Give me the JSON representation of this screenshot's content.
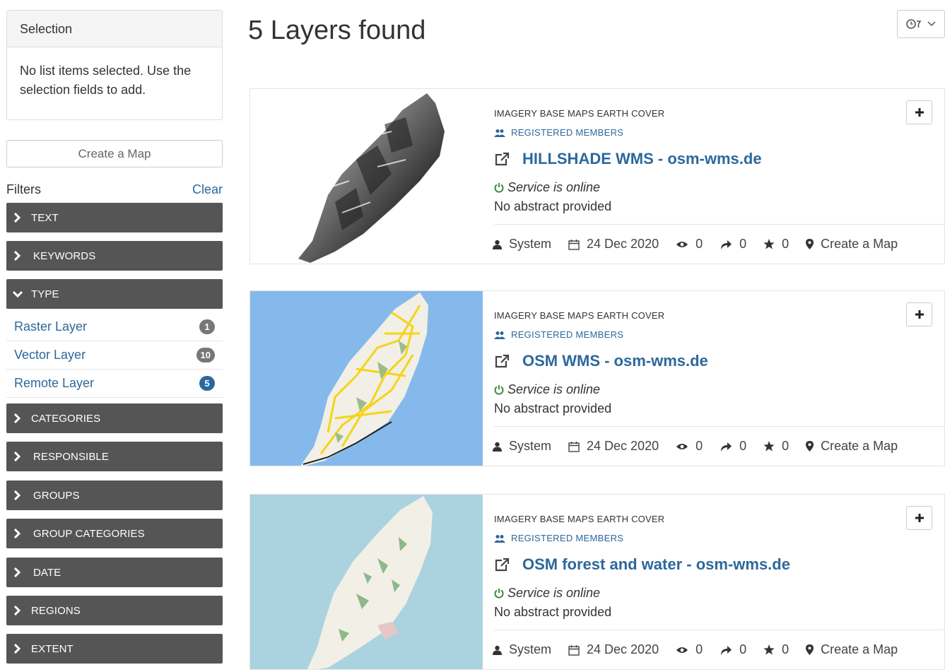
{
  "selection": {
    "header": "Selection",
    "empty_text": "No list items selected. Use the selection fields to add."
  },
  "create_map_label": "Create a Map",
  "filters": {
    "label": "Filters",
    "clear_label": "Clear",
    "sections": [
      {
        "label": "TEXT",
        "expanded": false
      },
      {
        "label": "KEYWORDS",
        "expanded": false
      },
      {
        "label": "TYPE",
        "expanded": true
      },
      {
        "label": "CATEGORIES",
        "expanded": false
      },
      {
        "label": "RESPONSIBLE",
        "expanded": false
      },
      {
        "label": "GROUPS",
        "expanded": false
      },
      {
        "label": "GROUP CATEGORIES",
        "expanded": false
      },
      {
        "label": "DATE",
        "expanded": false
      },
      {
        "label": "REGIONS",
        "expanded": false
      },
      {
        "label": "EXTENT",
        "expanded": false
      }
    ],
    "type_items": [
      {
        "label": "Raster Layer",
        "count": "1"
      },
      {
        "label": "Vector Layer",
        "count": "10"
      },
      {
        "label": "Remote Layer",
        "count": "5"
      }
    ]
  },
  "main": {
    "title": "5 Layers found",
    "sort_icon": "clock-sort-icon"
  },
  "layers": [
    {
      "categories": "IMAGERY BASE MAPS EARTH COVER",
      "permission": "REGISTERED MEMBERS",
      "title": "HILLSHADE WMS - osm-wms.de",
      "status": "Service is online",
      "abstract": "No abstract provided",
      "owner": "System",
      "date": "24 Dec 2020",
      "views": "0",
      "shares": "0",
      "stars": "0",
      "create_map": "Create a Map"
    },
    {
      "categories": "IMAGERY BASE MAPS EARTH COVER",
      "permission": "REGISTERED MEMBERS",
      "title": "OSM WMS - osm-wms.de",
      "status": "Service is online",
      "abstract": "No abstract provided",
      "owner": "System",
      "date": "24 Dec 2020",
      "views": "0",
      "shares": "0",
      "stars": "0",
      "create_map": "Create a Map"
    },
    {
      "categories": "IMAGERY BASE MAPS EARTH COVER",
      "permission": "REGISTERED MEMBERS",
      "title": "OSM forest and water - osm-wms.de",
      "status": "Service is online",
      "abstract": "No abstract provided",
      "owner": "System",
      "date": "24 Dec 2020",
      "views": "0",
      "shares": "0",
      "stars": "0",
      "create_map": "Create a Map"
    }
  ],
  "colors": {
    "accent": "#2c689c",
    "filter_bar": "#555555",
    "online": "#3a8a3a",
    "sea_osm": "#86b9eb",
    "sea_forest": "#aad3df"
  }
}
